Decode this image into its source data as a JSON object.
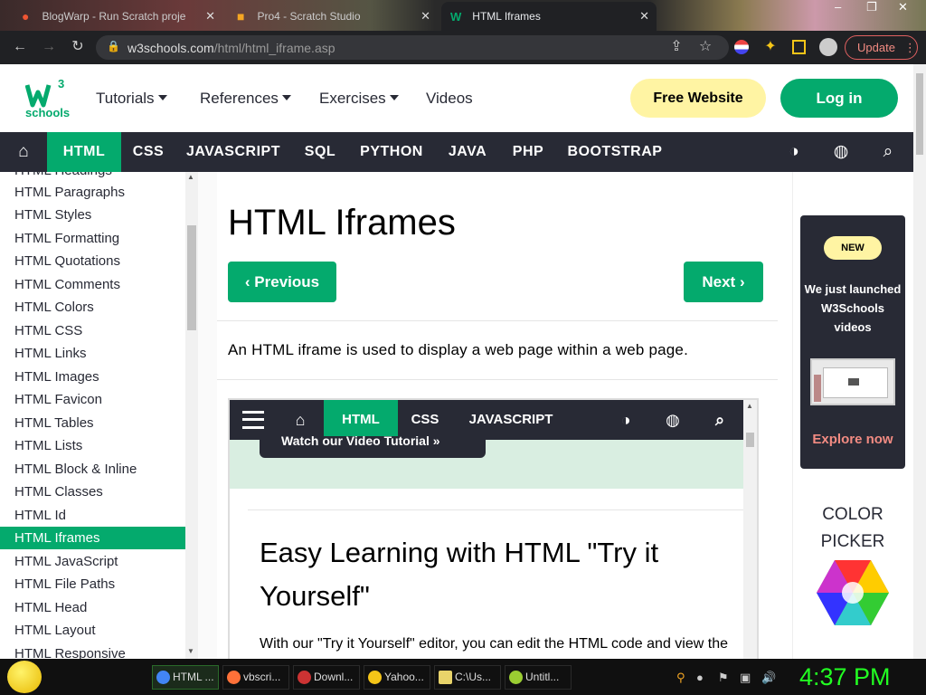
{
  "browser": {
    "tabs": [
      {
        "label": "BlogWarp - Run Scratch proje",
        "active": false
      },
      {
        "label": "Pro4 - Scratch Studio",
        "active": false
      },
      {
        "label": "HTML Iframes",
        "active": true
      }
    ],
    "url_host": "w3schools.com",
    "url_path": "/html/html_iframe.asp",
    "update_label": "Update",
    "window_controls": [
      "–",
      "❐",
      "✕"
    ]
  },
  "header": {
    "logo_text": "schools",
    "logo_sup": "3",
    "nav": [
      "Tutorials",
      "References",
      "Exercises",
      "Videos"
    ],
    "free_website": "Free Website",
    "login": "Log in"
  },
  "topnav": {
    "items": [
      "HTML",
      "CSS",
      "JAVASCRIPT",
      "SQL",
      "PYTHON",
      "JAVA",
      "PHP",
      "BOOTSTRAP"
    ],
    "active": "HTML"
  },
  "sidebar": {
    "items": [
      "HTML Headings",
      "HTML Paragraphs",
      "HTML Styles",
      "HTML Formatting",
      "HTML Quotations",
      "HTML Comments",
      "HTML Colors",
      "HTML CSS",
      "HTML Links",
      "HTML Images",
      "HTML Favicon",
      "HTML Tables",
      "HTML Lists",
      "HTML Block & Inline",
      "HTML Classes",
      "HTML Id",
      "HTML Iframes",
      "HTML JavaScript",
      "HTML File Paths",
      "HTML Head",
      "HTML Layout",
      "HTML Responsive"
    ],
    "active": "HTML Iframes"
  },
  "main": {
    "title": "HTML Iframes",
    "previous": "Previous",
    "next": "Next",
    "intro": "An HTML iframe is used to display a web page within a web page.",
    "iframe": {
      "nav": [
        "HTML",
        "CSS",
        "JAVASCRIPT"
      ],
      "video_button": "Watch our Video Tutorial »",
      "heading": "Easy Learning with HTML \"Try it Yourself\"",
      "paragraph": "With our \"Try it Yourself\" editor, you can edit the HTML code and view the result"
    }
  },
  "ad": {
    "badge": "NEW",
    "text": "We just launched W3Schools videos",
    "link": "Explore now",
    "color_picker": "COLOR PICKER"
  },
  "taskbar": {
    "items": [
      {
        "label": "HTML ...",
        "icon_color": "#4285f4",
        "active": true
      },
      {
        "label": "vbscri...",
        "icon_color": "#ff7139",
        "active": false
      },
      {
        "label": "Downl...",
        "icon_color": "#cc3333",
        "active": false
      },
      {
        "label": "Yahoo...",
        "icon_color": "#f5c518",
        "active": false
      },
      {
        "label": "C:\\Us...",
        "icon_color": "#e8d36a",
        "active": false
      },
      {
        "label": "Untitl...",
        "icon_color": "#9acd32",
        "active": false
      }
    ],
    "clock": "4:37 PM"
  },
  "colors": {
    "green": "#04aa6d",
    "dark": "#282a35",
    "yellow": "#fff4a3"
  }
}
